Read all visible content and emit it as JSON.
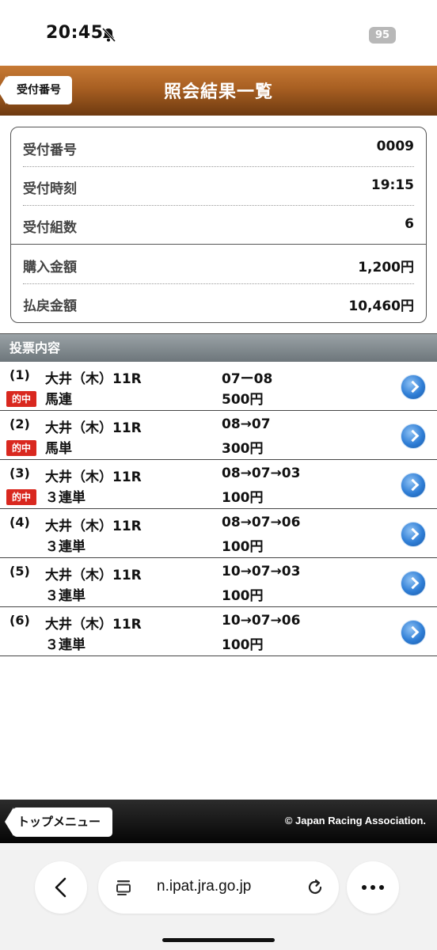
{
  "status_bar": {
    "time": "20:45",
    "battery": "95"
  },
  "header": {
    "back_label": "受付番号",
    "title": "照会結果一覧"
  },
  "info": [
    {
      "label": "受付番号",
      "value": "0009"
    },
    {
      "label": "受付時刻",
      "value": "19:15"
    },
    {
      "label": "受付組数",
      "value": "6"
    },
    {
      "label": "購入金額",
      "value": "1,200円"
    },
    {
      "label": "払戻金額",
      "value": "10,460円"
    }
  ],
  "section_title": "投票内容",
  "votes": [
    {
      "num": "(1)",
      "race": "大井（木）11R",
      "combo": "07ー08",
      "hit": "的中",
      "bet_type": "馬連",
      "amount": "500円"
    },
    {
      "num": "(2)",
      "race": "大井（木）11R",
      "combo": "08→07",
      "hit": "的中",
      "bet_type": "馬単",
      "amount": "300円"
    },
    {
      "num": "(3)",
      "race": "大井（木）11R",
      "combo": "08→07→03",
      "hit": "的中",
      "bet_type": "３連単",
      "amount": "100円"
    },
    {
      "num": "(4)",
      "race": "大井（木）11R",
      "combo": "08→07→06",
      "hit": "",
      "bet_type": "３連単",
      "amount": "100円"
    },
    {
      "num": "(5)",
      "race": "大井（木）11R",
      "combo": "10→07→03",
      "hit": "",
      "bet_type": "３連単",
      "amount": "100円"
    },
    {
      "num": "(6)",
      "race": "大井（木）11R",
      "combo": "10→07→06",
      "hit": "",
      "bet_type": "３連単",
      "amount": "100円"
    }
  ],
  "footer": {
    "top_menu_label": "トップメニュー",
    "copyright": "© Japan Racing Association."
  },
  "browser": {
    "url": "n.ipat.jra.go.jp"
  },
  "colors": {
    "header_brown": "#a85f22",
    "hit_red": "#d9281f",
    "arrow_blue": "#2f7ed6"
  }
}
